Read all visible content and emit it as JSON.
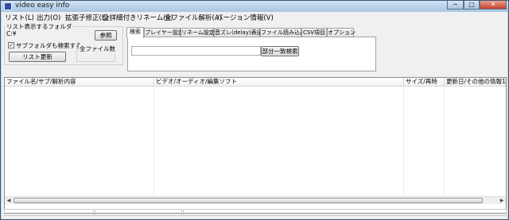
{
  "window": {
    "title": "video easy info",
    "minimize_glyph": "─",
    "maximize_glyph": "□",
    "close_glyph": "✕"
  },
  "menu": [
    {
      "label": "リスト(L)"
    },
    {
      "label": "出力(O)"
    },
    {
      "label": "拡張子修正(E)"
    },
    {
      "label": "全詳細付きリネーム(R)"
    },
    {
      "label": "全ファイル解析(A)"
    },
    {
      "label": "バージョン情報(V)"
    }
  ],
  "folder_panel": {
    "group_label": "リスト表示するフォルダ",
    "path_value": "C:¥",
    "browse_label": "参照",
    "subfolder_label": "サブフォルダも検索する",
    "subfolder_checked": true,
    "check_glyph": "✓",
    "refresh_label": "リスト更新",
    "total_files_label": "全ファイル数",
    "total_files_value": ""
  },
  "tabs": [
    {
      "label": "検索",
      "active": true
    },
    {
      "label": "プレイヤー設定",
      "active": false
    },
    {
      "label": "リネーム設定",
      "active": false
    },
    {
      "label": "音ズレ(delay)表記",
      "active": false
    },
    {
      "label": "ファイル読み込み",
      "active": false
    },
    {
      "label": "CSV項目",
      "active": false
    },
    {
      "label": "オプション",
      "active": false
    }
  ],
  "search": {
    "value": "",
    "button_label": "部分一致検索"
  },
  "list": {
    "columns": [
      "ファイル名/サブ/解析内容",
      "ビデオ/オーディオ/編集ソフト",
      "サイズ/再時",
      "更新日/その他の情報1/2"
    ],
    "rows": []
  },
  "scrollbar": {
    "left_arrow": "◀",
    "right_arrow": "▶"
  },
  "icons": {
    "app": "app-icon",
    "check": "check-icon",
    "scroll_left": "arrow-left-icon",
    "scroll_right": "arrow-right-icon"
  }
}
